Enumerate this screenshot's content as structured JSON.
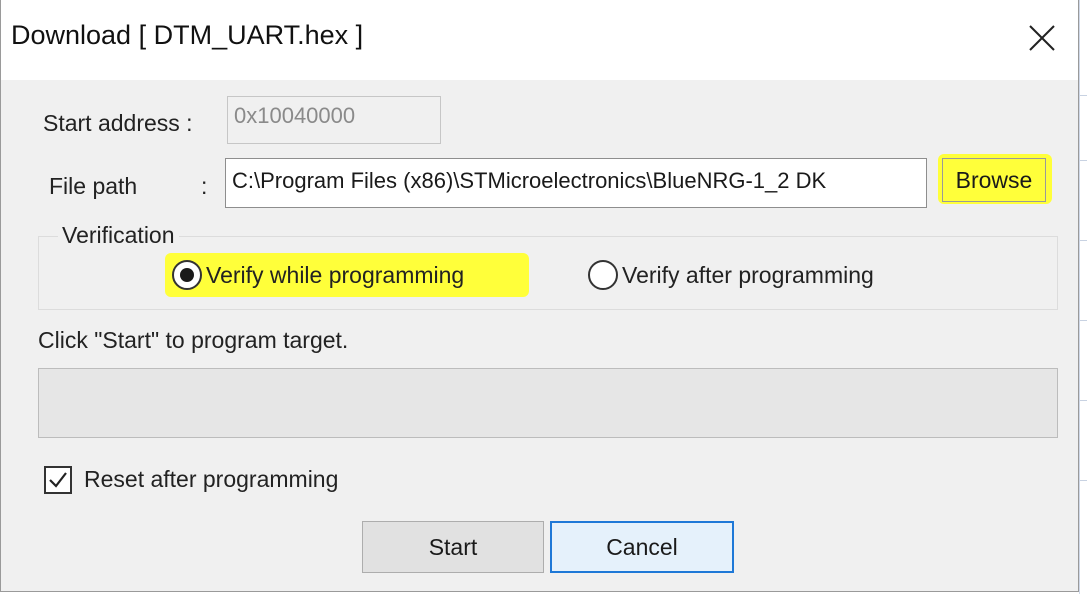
{
  "window": {
    "title": "Download [ DTM_UART.hex ]",
    "close_icon": "close-icon"
  },
  "start_address": {
    "label": "Start address :",
    "value": "0x10040000"
  },
  "file_path": {
    "label": "File path",
    "separator": ":",
    "value": "C:\\Program Files (x86)\\STMicroelectronics\\BlueNRG-1_2 DK",
    "browse_label": "Browse"
  },
  "verification": {
    "legend": "Verification",
    "options": [
      {
        "label": "Verify while programming",
        "selected": true
      },
      {
        "label": "Verify after programming",
        "selected": false
      }
    ]
  },
  "status": {
    "text": "Click \"Start\" to program target.",
    "progress": 0
  },
  "reset": {
    "label": "Reset after programming",
    "checked": true
  },
  "buttons": {
    "start_label": "Start",
    "cancel_label": "Cancel"
  },
  "colors": {
    "highlight": "#ffff3a",
    "default_button_border": "#1e78d7",
    "dialog_background": "#f0f0f0"
  }
}
